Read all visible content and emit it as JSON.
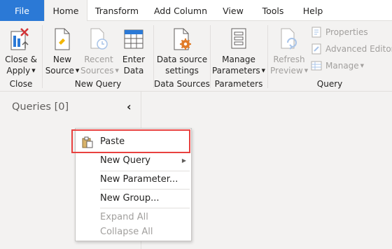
{
  "tabs": [
    "File",
    "Home",
    "Transform",
    "Add Column",
    "View",
    "Tools",
    "Help"
  ],
  "active_tab": "Home",
  "ribbon": {
    "close_apply": {
      "line1": "Close &",
      "line2": "Apply"
    },
    "new_source": {
      "line1": "New",
      "line2": "Source"
    },
    "recent_sources": {
      "line1": "Recent",
      "line2": "Sources"
    },
    "enter_data": {
      "line1": "Enter",
      "line2": "Data"
    },
    "data_source_settings": {
      "line1": "Data source",
      "line2": "settings"
    },
    "manage_parameters": {
      "line1": "Manage",
      "line2": "Parameters"
    },
    "refresh_preview": {
      "line1": "Refresh",
      "line2": "Preview"
    },
    "properties": "Properties",
    "advanced_editor": "Advanced Editor",
    "manage": "Manage",
    "groups": [
      "Close",
      "New Query",
      "Data Sources",
      "Parameters",
      "Query"
    ]
  },
  "queries_pane": {
    "title": "Queries [0]",
    "collapse_glyph": "‹"
  },
  "context_menu": {
    "items": [
      {
        "label": "Paste",
        "enabled": true
      },
      {
        "label": "New Query",
        "enabled": true,
        "submenu": true
      },
      {
        "label": "New Parameter...",
        "enabled": true
      },
      {
        "label": "New Group...",
        "enabled": true
      },
      {
        "label": "Expand All",
        "enabled": false
      },
      {
        "label": "Collapse All",
        "enabled": false
      }
    ]
  },
  "colors": {
    "file_tab": "#2b79d6",
    "highlight": "#e8413f",
    "disabled_text": "#a19f9d",
    "accent_icon": "#e07b28"
  }
}
